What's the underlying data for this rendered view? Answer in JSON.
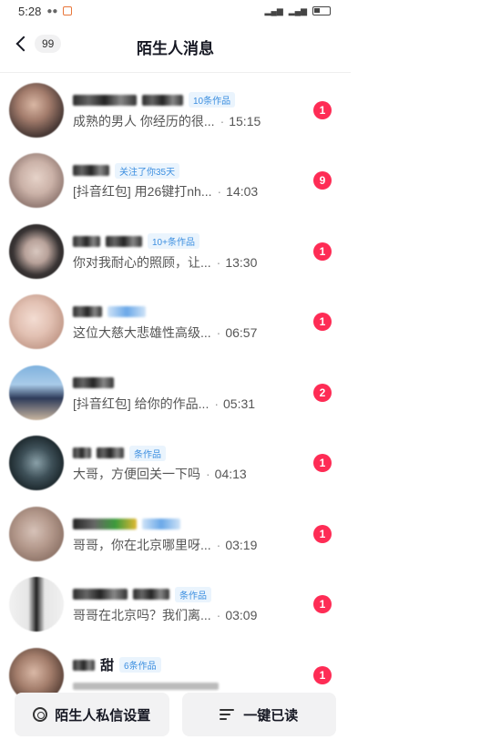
{
  "status": {
    "time": "5:28"
  },
  "header": {
    "title": "陌生人消息",
    "unread_count": "99"
  },
  "colors": {
    "badge": "#fe2c55",
    "tag_text": "#3d8fe0",
    "tag_bg": "#eaf4fd"
  },
  "conversations": [
    {
      "tag": "10条作品",
      "preview": "成熟的男人 你经历的很...",
      "time": "15:15",
      "badge": "1"
    },
    {
      "tag": "关注了你35天",
      "preview": "[抖音红包] 用26键打nh...",
      "time": "14:03",
      "badge": "9"
    },
    {
      "tag": "10+条作品",
      "preview": "你对我耐心的照顾，让...",
      "time": "13:30",
      "badge": "1"
    },
    {
      "tag": "",
      "preview": "这位大慈大悲雄性高级...",
      "time": "06:57",
      "badge": "1"
    },
    {
      "tag": "",
      "preview": "[抖音红包] 给你的作品...",
      "time": "05:31",
      "badge": "2"
    },
    {
      "tag": "条作品",
      "preview": "大哥，方便回关一下吗",
      "time": "04:13",
      "badge": "1"
    },
    {
      "tag": "",
      "preview": "哥哥，你在北京哪里呀...",
      "time": "03:19",
      "badge": "1"
    },
    {
      "tag": "条作品",
      "preview": "哥哥在北京吗？我们离...",
      "time": "03:09",
      "badge": "1"
    },
    {
      "name": "甜",
      "tag": "6条作品",
      "preview": "",
      "time": "",
      "badge": "1"
    }
  ],
  "bottom": {
    "settings_label": "陌生人私信设置",
    "read_all_label": "一键已读"
  }
}
